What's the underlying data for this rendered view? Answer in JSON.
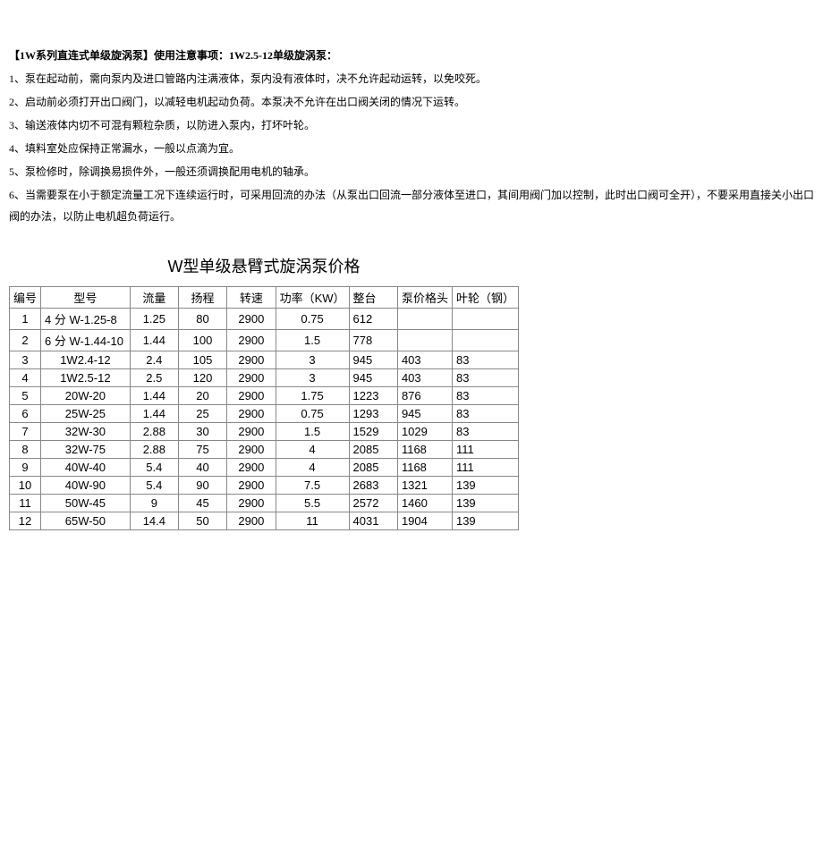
{
  "intro": {
    "title": "【1W系列直连式单级旋涡泵】使用注意事项：1W2.5-12单级旋涡泵：",
    "items": [
      "1、泵在起动前，需向泵内及进口管路内注满液体，泵内没有液体时，决不允许起动运转，以免咬死。",
      "2、启动前必须打开出口阀门，以减轻电机起动负荷。本泵决不允许在出口阀关闭的情况下运转。",
      "3、输送液体内切不可混有颗粒杂质，以防进入泵内，打坏叶轮。",
      "4、填料室处应保持正常漏水，一般以点滴为宜。",
      "5、泵检修时，除调换易损件外，一般还须调换配用电机的轴承。",
      "6、当需要泵在小于额定流量工况下连续运行时，可采用回流的办法（从泵出口回流一部分液体至进口，其间用阀门加以控制，此时出口阀可全开），不要采用直接关小出口阀的办法，以防止电机超负荷运行。"
    ]
  },
  "table": {
    "title": "W型单级悬臂式旋涡泵价格",
    "headers": {
      "no": "编号",
      "model": "型号",
      "flow": "流量",
      "head": "扬程",
      "speed": "转速",
      "power": "功率（KW）",
      "whole": "整台",
      "pump": "泵价格头",
      "impeller": "叶轮（钢）"
    },
    "rows": [
      {
        "no": "1",
        "model": "4 分 W-1.25-8",
        "flow": "1.25",
        "head": "80",
        "speed": "2900",
        "power": "0.75",
        "whole": "612",
        "pump": "",
        "impeller": ""
      },
      {
        "no": "2",
        "model": "6 分 W-1.44-10",
        "flow": "1.44",
        "head": "100",
        "speed": "2900",
        "power": "1.5",
        "whole": "778",
        "pump": "",
        "impeller": ""
      },
      {
        "no": "3",
        "model": "1W2.4-12",
        "flow": "2.4",
        "head": "105",
        "speed": "2900",
        "power": "3",
        "whole": "945",
        "pump": "403",
        "impeller": "83"
      },
      {
        "no": "4",
        "model": "1W2.5-12",
        "flow": "2.5",
        "head": "120",
        "speed": "2900",
        "power": "3",
        "whole": "945",
        "pump": "403",
        "impeller": "83"
      },
      {
        "no": "5",
        "model": "20W-20",
        "flow": "1.44",
        "head": "20",
        "speed": "2900",
        "power": "1.75",
        "whole": "1223",
        "pump": "876",
        "impeller": "83"
      },
      {
        "no": "6",
        "model": "25W-25",
        "flow": "1.44",
        "head": "25",
        "speed": "2900",
        "power": "0.75",
        "whole": "1293",
        "pump": "945",
        "impeller": "83"
      },
      {
        "no": "7",
        "model": "32W-30",
        "flow": "2.88",
        "head": "30",
        "speed": "2900",
        "power": "1.5",
        "whole": "1529",
        "pump": "1029",
        "impeller": "83"
      },
      {
        "no": "8",
        "model": "32W-75",
        "flow": "2.88",
        "head": "75",
        "speed": "2900",
        "power": "4",
        "whole": "2085",
        "pump": "1168",
        "impeller": "111"
      },
      {
        "no": "9",
        "model": "40W-40",
        "flow": "5.4",
        "head": "40",
        "speed": "2900",
        "power": "4",
        "whole": "2085",
        "pump": "1168",
        "impeller": "111"
      },
      {
        "no": "10",
        "model": "40W-90",
        "flow": "5.4",
        "head": "90",
        "speed": "2900",
        "power": "7.5",
        "whole": "2683",
        "pump": "1321",
        "impeller": "139"
      },
      {
        "no": "11",
        "model": "50W-45",
        "flow": "9",
        "head": "45",
        "speed": "2900",
        "power": "5.5",
        "whole": "2572",
        "pump": "1460",
        "impeller": "139"
      },
      {
        "no": "12",
        "model": "65W-50",
        "flow": "14.4",
        "head": "50",
        "speed": "2900",
        "power": "11",
        "whole": "4031",
        "pump": "1904",
        "impeller": "139"
      }
    ]
  }
}
